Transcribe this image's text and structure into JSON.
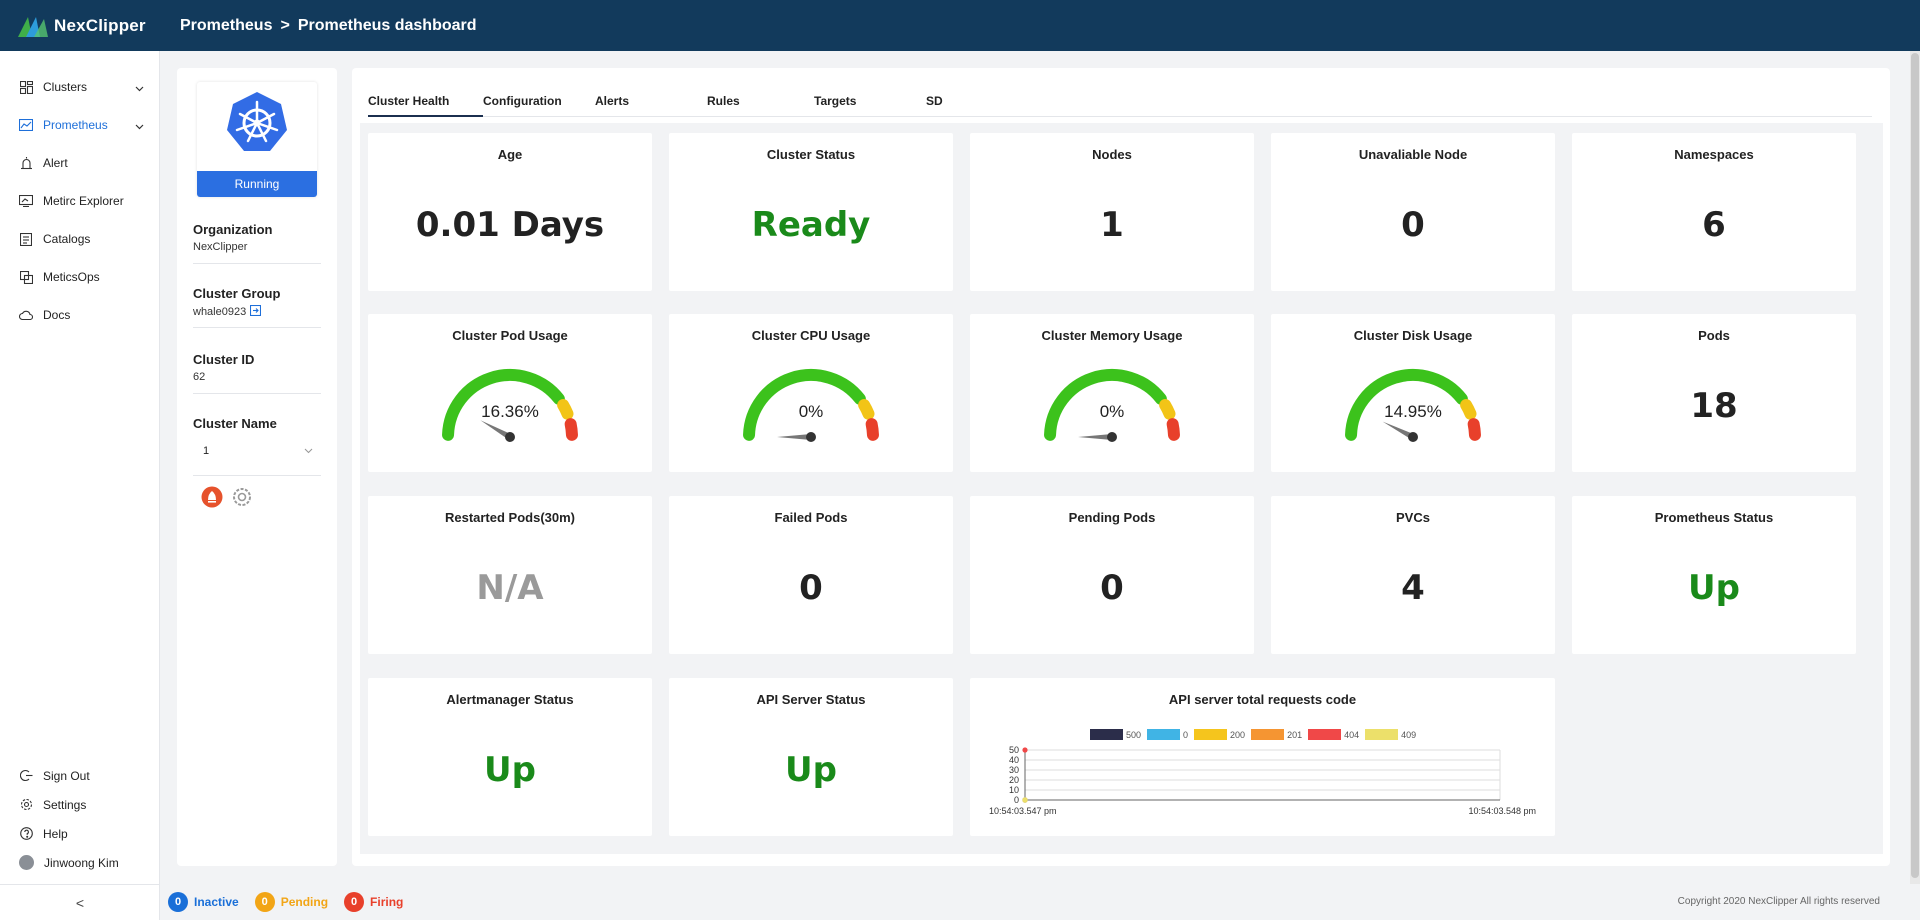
{
  "app": {
    "logo": "NexClipper"
  },
  "breadcrumb": {
    "parent": "Prometheus",
    "separator": ">",
    "current": "Prometheus dashboard"
  },
  "sidebar": {
    "items": [
      {
        "label": "Clusters",
        "icon": "dashboard-icon"
      },
      {
        "label": "Prometheus",
        "icon": "chart-line-icon"
      },
      {
        "label": "Alert",
        "icon": "alarm-icon"
      },
      {
        "label": "Metirc Explorer",
        "icon": "explorer-icon"
      },
      {
        "label": "Catalogs",
        "icon": "catalog-icon"
      },
      {
        "label": "MeticsOps",
        "icon": "ops-icon"
      },
      {
        "label": "Docs",
        "icon": "cloud-icon"
      }
    ],
    "bottom": [
      {
        "label": "Sign Out",
        "icon": "sign-out-icon"
      },
      {
        "label": "Settings",
        "icon": "gear-icon"
      },
      {
        "label": "Help",
        "icon": "help-icon"
      },
      {
        "label": "Jinwoong Kim",
        "icon": "avatar"
      }
    ],
    "collapse": "<"
  },
  "cluster_info": {
    "status": "Running",
    "organization_label": "Organization",
    "organization": "NexClipper",
    "group_label": "Cluster Group",
    "group": "whale0923",
    "id_label": "Cluster ID",
    "id": "62",
    "name_label": "Cluster Name",
    "name": "1"
  },
  "tabs": [
    "Cluster Health",
    "Configuration",
    "Alerts",
    "Rules",
    "Targets",
    "SD"
  ],
  "stats": {
    "age": {
      "title": "Age",
      "value": "0.01 Days"
    },
    "cluster_status": {
      "title": "Cluster Status",
      "value": "Ready"
    },
    "nodes": {
      "title": "Nodes",
      "value": "1"
    },
    "unavailable_node": {
      "title": "Unavaliable Node",
      "value": "0"
    },
    "namespaces": {
      "title": "Namespaces",
      "value": "6"
    },
    "pods": {
      "title": "Pods",
      "value": "18"
    },
    "restarted_pods": {
      "title": "Restarted Pods(30m)",
      "value": "N/A"
    },
    "failed_pods": {
      "title": "Failed Pods",
      "value": "0"
    },
    "pending_pods": {
      "title": "Pending Pods",
      "value": "0"
    },
    "pvcs": {
      "title": "PVCs",
      "value": "4"
    },
    "prometheus_status": {
      "title": "Prometheus Status",
      "value": "Up"
    },
    "alertmanager_status": {
      "title": "Alertmanager Status",
      "value": "Up"
    },
    "api_server_status": {
      "title": "API Server Status",
      "value": "Up"
    }
  },
  "gauges": [
    {
      "title": "Cluster Pod Usage",
      "label": "16.36%",
      "value": 16.36
    },
    {
      "title": "Cluster CPU Usage",
      "label": "0%",
      "value": 0
    },
    {
      "title": "Cluster Memory Usage",
      "label": "0%",
      "value": 0
    },
    {
      "title": "Cluster Disk Usage",
      "label": "14.95%",
      "value": 14.95
    }
  ],
  "colors": {
    "gauge_green": "#3cc21c",
    "gauge_yellow": "#f2c417",
    "gauge_red": "#e8402b",
    "status_green": "#1a8a1a",
    "topbar": "#123a5c",
    "accent": "#1e6fd9"
  },
  "chart_data": {
    "type": "line",
    "title": "API server total requests code",
    "series": [
      {
        "name": "500",
        "color": "#2b2d4a",
        "values": [
          0,
          0
        ]
      },
      {
        "name": "0",
        "color": "#40b4e5",
        "values": [
          0,
          0
        ]
      },
      {
        "name": "200",
        "color": "#f5c51d",
        "values": [
          0,
          0
        ]
      },
      {
        "name": "201",
        "color": "#f59532",
        "values": [
          0,
          0
        ]
      },
      {
        "name": "404",
        "color": "#f04848",
        "values": [
          50,
          0
        ]
      },
      {
        "name": "409",
        "color": "#ece06a",
        "values": [
          0,
          0
        ]
      }
    ],
    "x": [
      "10:54:03.547 pm",
      "10:54:03.548 pm"
    ],
    "yticks": [
      0,
      10,
      20,
      30,
      40,
      50
    ],
    "ylim": [
      0,
      50
    ],
    "grid": true,
    "legend": "top"
  },
  "footer": {
    "inactive_count": "0",
    "inactive_label": "Inactive",
    "pending_count": "0",
    "pending_label": "Pending",
    "firing_count": "0",
    "firing_label": "Firing",
    "copyright": "Copyright 2020 NexClipper All rights reserved"
  }
}
